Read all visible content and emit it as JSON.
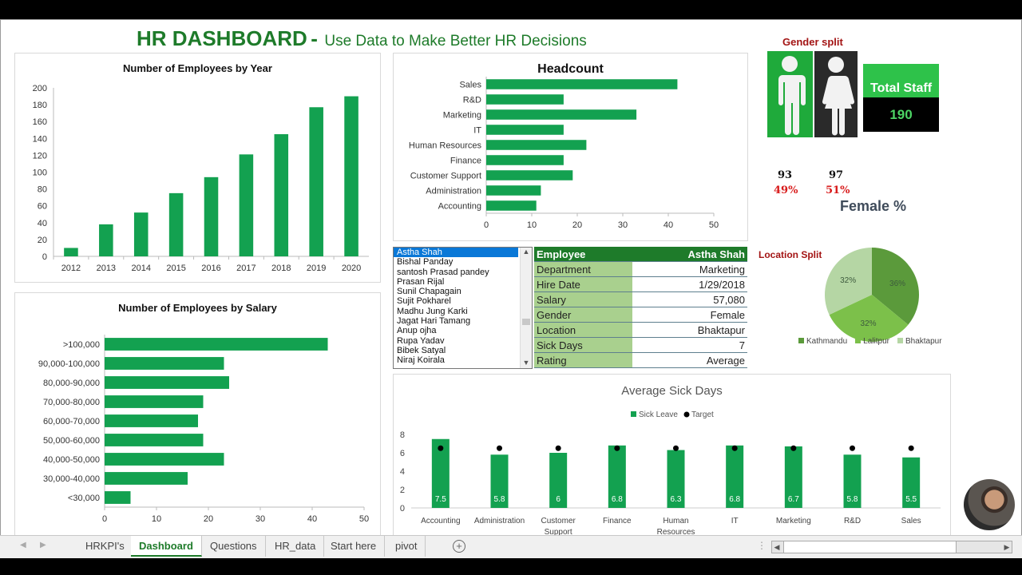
{
  "header": {
    "title": "HR DASHBOARD",
    "separator": "-",
    "subtitle": "Use Data to Make Better HR Decisions"
  },
  "colors": {
    "accent_green": "#13a150",
    "title_green": "#1e7b2a",
    "red_label": "#a31414",
    "pie_kathmandu": "#5b9a3b",
    "pie_lalitpur": "#7cc04a",
    "pie_bhaktapur": "#b5d6a4"
  },
  "gender": {
    "title": "Gender split",
    "male_count": "93",
    "male_pct": "49%",
    "female_count": "97",
    "female_pct": "51%"
  },
  "total_staff": {
    "label": "Total Staff",
    "value": "190"
  },
  "female_pct_title": "Female %",
  "location_split_label": "Location Split",
  "employee_list": {
    "selected": "Astha Shah",
    "items": [
      "Astha Shah",
      "Bishal Panday",
      "santosh Prasad pandey",
      "Prasan Rijal",
      "Sunil Chapagain",
      "Sujit Pokharel",
      "Madhu Jung Karki",
      "Jagat Hari Tamang",
      "Anup ojha",
      "Rupa Yadav",
      "Bibek Satyal",
      "Niraj Koirala"
    ]
  },
  "employee_card": {
    "header_key": "Employee",
    "header_value": "Astha Shah",
    "rows": [
      {
        "key": "Department",
        "value": "Marketing"
      },
      {
        "key": "Hire Date",
        "value": "1/29/2018"
      },
      {
        "key": "Salary",
        "value": "57,080"
      },
      {
        "key": "Gender",
        "value": "Female"
      },
      {
        "key": "Location",
        "value": "Bhaktapur"
      },
      {
        "key": "Sick Days",
        "value": "7"
      },
      {
        "key": "Rating",
        "value": "Average"
      }
    ]
  },
  "sheet_tabs": [
    {
      "label": "HRKPI's",
      "active": false
    },
    {
      "label": "Dashboard",
      "active": true
    },
    {
      "label": "Questions",
      "active": false
    },
    {
      "label": "HR_data",
      "active": false
    },
    {
      "label": "Start here",
      "active": false
    },
    {
      "label": "pivot",
      "active": false
    }
  ],
  "chart_data": [
    {
      "id": "by_year",
      "type": "bar",
      "title": "Number of Employees by Year",
      "categories": [
        "2012",
        "2013",
        "2014",
        "2015",
        "2016",
        "2017",
        "2018",
        "2019",
        "2020"
      ],
      "values": [
        10,
        38,
        52,
        75,
        94,
        121,
        145,
        177,
        190
      ],
      "ylim": [
        0,
        200
      ],
      "yticks": [
        0,
        20,
        40,
        60,
        80,
        100,
        120,
        140,
        160,
        180,
        200
      ],
      "xlabel": "",
      "ylabel": "",
      "grid": false
    },
    {
      "id": "headcount",
      "type": "bar",
      "orientation": "horizontal",
      "title": "Headcount",
      "categories": [
        "Sales",
        "R&D",
        "Marketing",
        "IT",
        "Human Resources",
        "Finance",
        "Customer Support",
        "Administration",
        "Accounting"
      ],
      "values": [
        42,
        17,
        33,
        17,
        22,
        17,
        19,
        12,
        11
      ],
      "xlim": [
        0,
        50
      ],
      "xticks": [
        0,
        10,
        20,
        30,
        40,
        50
      ],
      "grid": false
    },
    {
      "id": "by_salary",
      "type": "bar",
      "orientation": "horizontal",
      "title": "Number of Employees by Salary",
      "categories": [
        ">100,000",
        "90,000-100,000",
        "80,000-90,000",
        "70,000-80,000",
        "60,000-70,000",
        "50,000-60,000",
        "40,000-50,000",
        "30,000-40,000",
        "<30,000"
      ],
      "values": [
        43,
        23,
        24,
        19,
        18,
        19,
        23,
        16,
        5
      ],
      "xlim": [
        0,
        50
      ],
      "xticks": [
        0,
        10,
        20,
        30,
        40,
        50
      ],
      "grid": false
    },
    {
      "id": "female_location",
      "type": "pie",
      "title": "Female %",
      "labels": [
        "Kathmandu",
        "Lalitpur",
        "Bhaktapur"
      ],
      "values": [
        36,
        32,
        32
      ],
      "value_labels": [
        "36%",
        "32%",
        "32%"
      ],
      "legend": "bottom"
    },
    {
      "id": "sick_days",
      "type": "bar",
      "title": "Average Sick Days",
      "categories": [
        "Accounting",
        "Administration",
        "Customer Support",
        "Finance",
        "Human Resources",
        "IT",
        "Marketing",
        "R&D",
        "Sales"
      ],
      "category_lines": [
        [
          "Accounting"
        ],
        [
          "Administration"
        ],
        [
          "Customer",
          "Support"
        ],
        [
          "Finance"
        ],
        [
          "Human",
          "Resources"
        ],
        [
          "IT"
        ],
        [
          "Marketing"
        ],
        [
          "R&D"
        ],
        [
          "Sales"
        ]
      ],
      "series": [
        {
          "name": "Sick Leave",
          "type": "bar",
          "values": [
            7.5,
            5.8,
            6,
            6.8,
            6.3,
            6.8,
            6.7,
            5.8,
            5.5
          ],
          "labels": [
            "7.5",
            "5.8",
            "6",
            "6.8",
            "6.3",
            "6.8",
            "6.7",
            "5.8",
            "5.5"
          ]
        },
        {
          "name": "Target",
          "type": "scatter",
          "values": [
            6.5,
            6.5,
            6.5,
            6.5,
            6.5,
            6.5,
            6.5,
            6.5,
            6.5
          ]
        }
      ],
      "ylim": [
        0,
        8
      ],
      "yticks": [
        0,
        2,
        4,
        6,
        8
      ],
      "legend": "top"
    }
  ]
}
